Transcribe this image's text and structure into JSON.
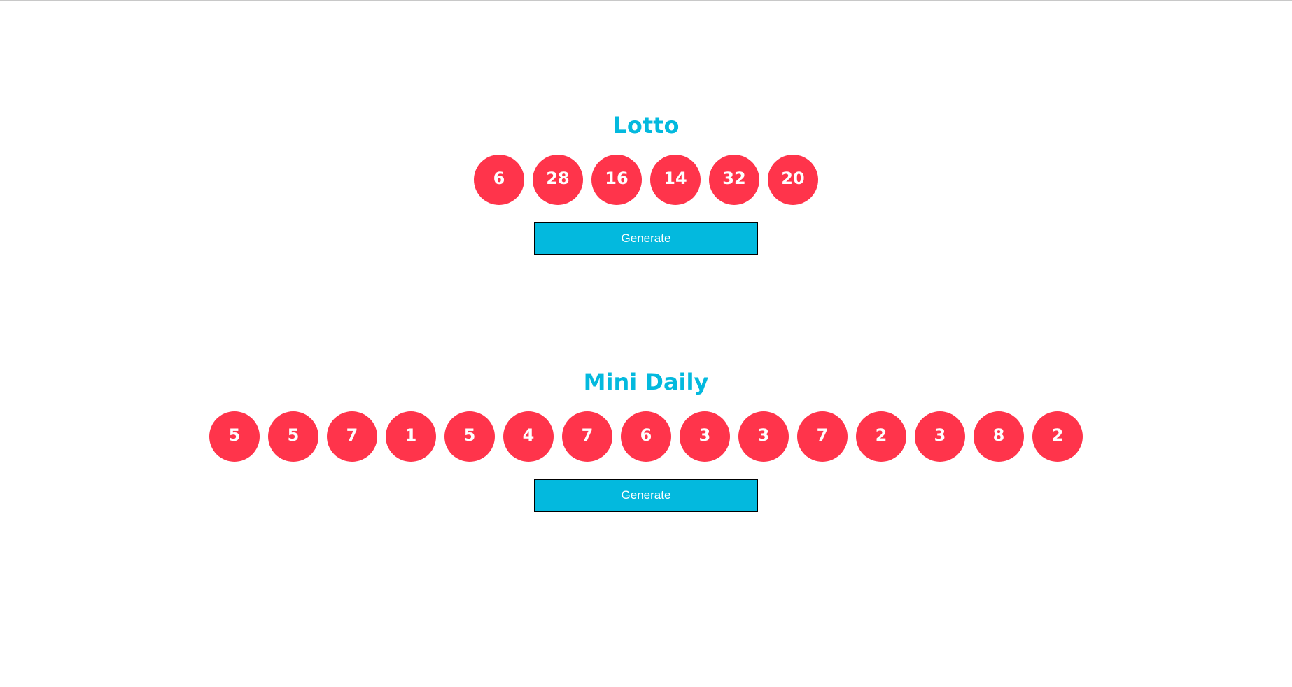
{
  "colors": {
    "title": "#03b9de",
    "ball": "#ff344b",
    "button": "#03b9de",
    "button_border": "#000000"
  },
  "lotto": {
    "title": "Lotto",
    "numbers": [
      "6",
      "28",
      "16",
      "14",
      "32",
      "20"
    ],
    "button_label": "Generate"
  },
  "mini_daily": {
    "title": "Mini Daily",
    "numbers": [
      "5",
      "5",
      "7",
      "1",
      "5",
      "4",
      "7",
      "6",
      "3",
      "3",
      "7",
      "2",
      "3",
      "8",
      "2"
    ],
    "button_label": "Generate"
  }
}
